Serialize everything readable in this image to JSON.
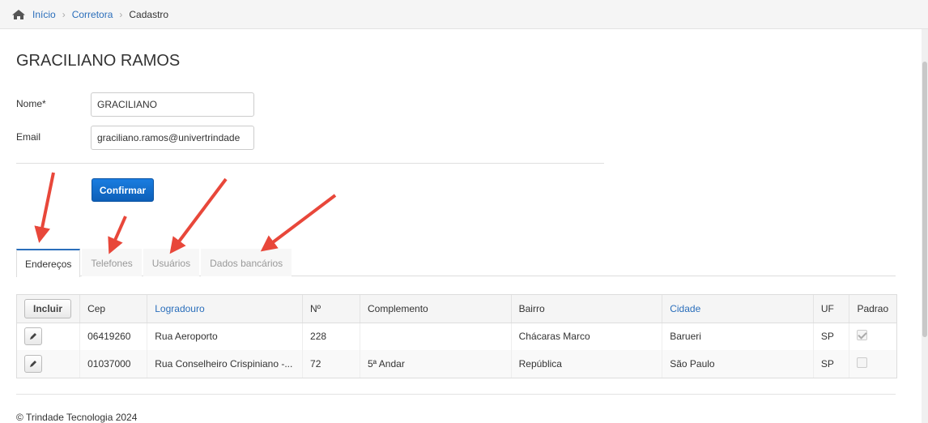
{
  "breadcrumb": {
    "home": "Início",
    "level1": "Corretora",
    "current": "Cadastro"
  },
  "page_title": "GRACILIANO RAMOS",
  "form": {
    "nome_label": "Nome*",
    "nome_value": "GRACILIANO",
    "email_label": "Email",
    "email_value": "graciliano.ramos@univertrindade"
  },
  "confirm_label": "Confirmar",
  "tabs": [
    {
      "label": "Endereços",
      "active": true
    },
    {
      "label": "Telefones",
      "active": false
    },
    {
      "label": "Usuários",
      "active": false
    },
    {
      "label": "Dados bancários",
      "active": false
    }
  ],
  "table": {
    "incluir_label": "Incluir",
    "headers": [
      "Cep",
      "Logradouro",
      "Nº",
      "Complemento",
      "Bairro",
      "Cidade",
      "UF",
      "Padrao"
    ],
    "rows": [
      {
        "cep": "06419260",
        "logradouro": "Rua Aeroporto",
        "numero": "228",
        "complemento": "",
        "bairro": "Chácaras Marco",
        "cidade": "Barueri",
        "uf": "SP",
        "padrao": true
      },
      {
        "cep": "01037000",
        "logradouro": "Rua Conselheiro Crispiniano -...",
        "numero": "72",
        "complemento": "5ª Andar",
        "bairro": "República",
        "cidade": "São Paulo",
        "uf": "SP",
        "padrao": false
      }
    ]
  },
  "footer": "© Trindade Tecnologia 2024",
  "colors": {
    "link": "#2a6ebb",
    "primary_button": "#1a7de0",
    "annotation_arrow": "#e8473a"
  },
  "icons": [
    "home-icon",
    "pencil-icon"
  ]
}
